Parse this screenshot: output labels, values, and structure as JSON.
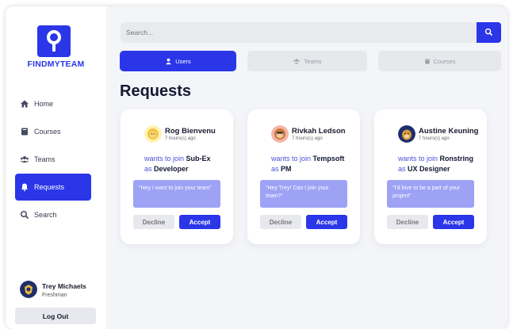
{
  "brand": {
    "name": "FINDMYTEAM"
  },
  "colors": {
    "accent": "#2a36e8",
    "message_bg": "#9da2f5"
  },
  "sidebar": {
    "items": [
      {
        "label": "Home",
        "icon": "home-icon"
      },
      {
        "label": "Courses",
        "icon": "book-icon"
      },
      {
        "label": "Teams",
        "icon": "users-icon"
      },
      {
        "label": "Requests",
        "icon": "bell-icon"
      },
      {
        "label": "Search",
        "icon": "search-icon"
      }
    ],
    "active": "Requests"
  },
  "user": {
    "name": "Trey Michaels",
    "role": "Freshman",
    "logout_label": "Log Out"
  },
  "search": {
    "placeholder": "Search..."
  },
  "tabs": [
    {
      "label": "Users",
      "icon": "user-icon",
      "active": true
    },
    {
      "label": "Teams",
      "icon": "users-icon",
      "active": false
    },
    {
      "label": "Courses",
      "icon": "book-icon",
      "active": false
    }
  ],
  "page": {
    "title": "Requests"
  },
  "requests": [
    {
      "name": "Rog Bienvenu",
      "time": "7 hours(s) ago",
      "wants": "wants to join",
      "team": "Sub-Ex",
      "as": "as",
      "role": "Developer",
      "message": "\"Hey I want to join your team\"",
      "decline": "Decline",
      "accept": "Accept"
    },
    {
      "name": "Rivkah Ledson",
      "time": "7 hours(s) ago",
      "wants": "wants to join",
      "team": "Tempsoft",
      "as": "as",
      "role": "PM",
      "message": "\"Hey Trey! Can I join your team?\"",
      "decline": "Decline",
      "accept": "Accept"
    },
    {
      "name": "Austine Keuning",
      "time": "7 hours(s) ago",
      "wants": "wants to join",
      "team": "Ronstring",
      "as": "as",
      "role": "UX Designer",
      "message": "\"I'd love to be a part of your project\"",
      "decline": "Decline",
      "accept": "Accept"
    }
  ]
}
